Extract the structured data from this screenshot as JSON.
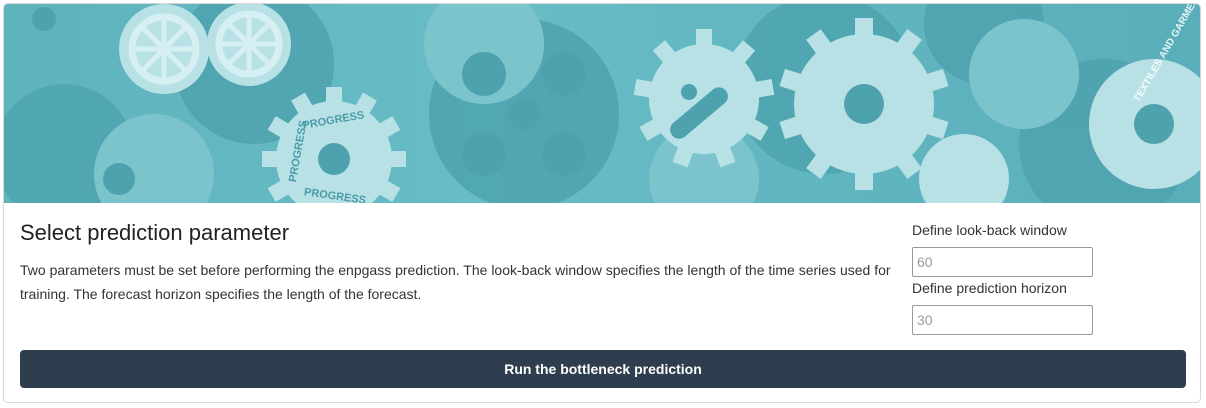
{
  "banner": {
    "gear_texts": [
      "PROGRESS",
      "PROGRESS",
      "PROGRESS",
      "TEXTILES AND GARMENTS"
    ],
    "colors": {
      "teal": "#62b6c0",
      "light": "#a9dbe1",
      "pale": "#cdebee",
      "dark": "#3f98a4"
    }
  },
  "section": {
    "title": "Select prediction parameter",
    "description": "Two parameters must be set before performing the enpgass prediction. The look-back window specifies the length of the time series used for training. The forecast horizon specifies the length of the forecast."
  },
  "lookback": {
    "label": "Define look-back window",
    "placeholder": "60"
  },
  "horizon": {
    "label": "Define prediction horizon",
    "placeholder": "30"
  },
  "run_button": {
    "label": "Run the bottleneck prediction",
    "color": "#2e3e4e"
  }
}
